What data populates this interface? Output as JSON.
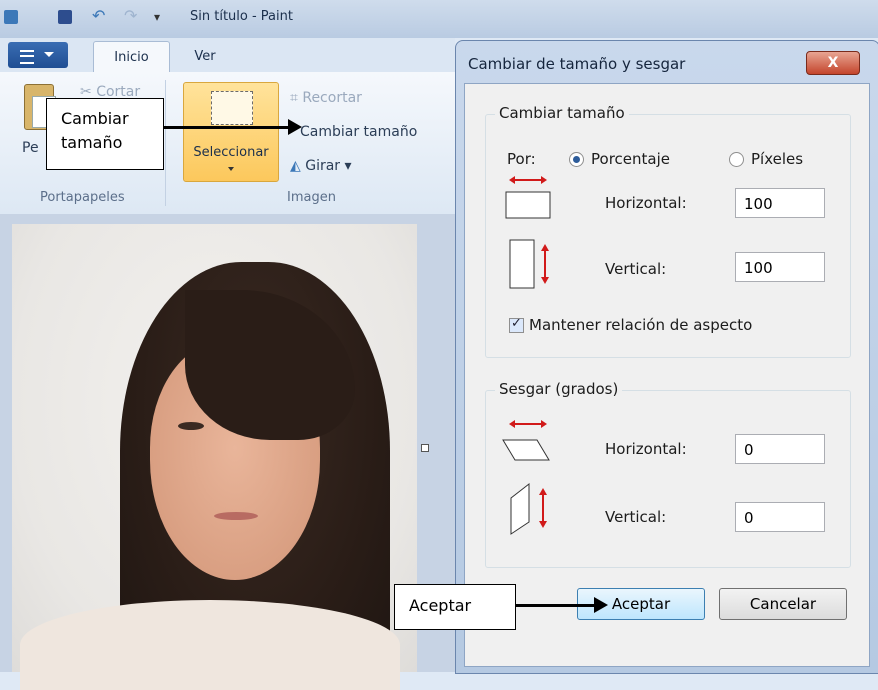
{
  "window": {
    "title": "Sin título - Paint"
  },
  "ribbon": {
    "tabs": [
      "Inicio",
      "Ver"
    ],
    "clipboard": {
      "paste": "Pe",
      "cut": "Cortar",
      "group": "Portapapeles"
    },
    "image": {
      "select": "Seleccionar",
      "crop": "Recortar",
      "resize": "Cambiar tamaño",
      "rotate": "Girar ▾",
      "group": "Imagen"
    }
  },
  "dialog": {
    "title": "Cambiar de tamaño y sesgar",
    "close": "X",
    "resize": {
      "legend": "Cambiar tamaño",
      "by_label": "Por:",
      "option_percent": "Porcentaje",
      "option_pixels": "Píxeles",
      "horizontal_label": "Horizontal:",
      "horizontal_value": "100",
      "vertical_label": "Vertical:",
      "vertical_value": "100",
      "keep_aspect": "Mantener relación de aspecto"
    },
    "skew": {
      "legend": "Sesgar (grados)",
      "horizontal_label": "Horizontal:",
      "horizontal_value": "0",
      "vertical_label": "Vertical:",
      "vertical_value": "0"
    },
    "ok": "Aceptar",
    "cancel": "Cancelar"
  },
  "annotations": {
    "resize_callout": "Cambiar tamaño",
    "ok_callout": "Aceptar"
  },
  "colors": {
    "accent_red": "#d11a1a",
    "select_yellow": "#fcc85c"
  }
}
